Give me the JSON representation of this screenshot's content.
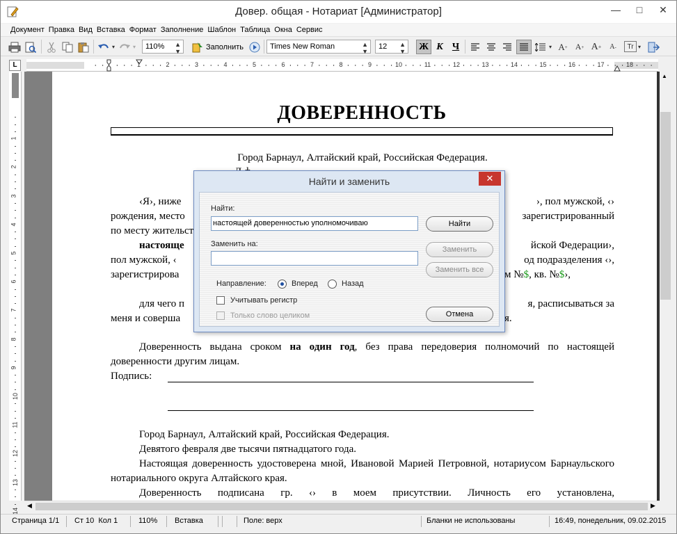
{
  "window": {
    "title": "Довер. общая - Нотариат [Администратор]"
  },
  "menu": [
    "Документ",
    "Правка",
    "Вид",
    "Вставка",
    "Формат",
    "Заполнение",
    "Шаблон",
    "Таблица",
    "Окна",
    "Сервис"
  ],
  "toolbar": {
    "zoom": "110%",
    "fill_label": "Заполнить",
    "font": "Times New Roman",
    "size": "12",
    "bold": "Ж",
    "italic": "К",
    "underline": "Ч"
  },
  "document": {
    "title": "ДОВЕРЕННОСТЬ",
    "city_line": "Город Барнаул, Алтайский край, Российская Федерация.",
    "date_line_fragment": "Д          ф",
    "p1_a": "‹Я›, ниже",
    "p1_b": "›, пол мужской, ‹›",
    "p1_c": "рождения, место",
    "p1_d": "зарегистрированный",
    "p1_e": "по месту жительства",
    "p2_a": "настояще",
    "p2_b": "йской Федерации›,",
    "p2_c": "пол мужской, ‹",
    "p2_d": "од подразделения ‹›,",
    "p2_e": "зарегистрирова",
    "p2_f": "м №",
    "p2_g": ", кв. №",
    "p2_h": "›,",
    "dollar": "$",
    "p3_a": "для чего п",
    "p3_b": "я, расписываться за",
    "p3_c": "меня и соверша",
    "p3_d": "я.",
    "p4_pre": "Доверенность выдана сроком ",
    "p4_bold": "на один год",
    "p4_post": ", без права передоверия полномочий по настоящей доверенности другим лицам.",
    "signature_label": "Подпись:",
    "cert_city": "Город Барнаул, Алтайский край, Российская Федерация.",
    "cert_date": "Девятого февраля две тысячи пятнадцатого года.",
    "cert_text": "Настоящая доверенность удостоверена мной, Ивановой Марией Петровной, нотариусом Барнаульского нотариального округа Алтайского края.",
    "cert_sign": "Доверенность подписана гр. ‹› в моем присутствии. Личность его установлена,"
  },
  "dialog": {
    "title": "Найти и заменить",
    "find_label": "Найти:",
    "find_value": "настоящей доверенностью уполномочиваю",
    "replace_label": "Заменить на:",
    "replace_value": "",
    "direction_label": "Направление:",
    "forward": "Вперед",
    "backward": "Назад",
    "match_case": "Учитывать регистр",
    "whole_word": "Только слово целиком",
    "btn_find": "Найти",
    "btn_replace": "Заменить",
    "btn_replace_all": "Заменить все",
    "btn_cancel": "Отмена"
  },
  "status": {
    "page": "Страница 1/1",
    "pos": "Ст 10  Кол 1",
    "zoom": "110%",
    "mode": "Вставка",
    "field": "Поле: верх",
    "forms": "Бланки не использованы",
    "datetime": "16:49, понедельник, 09.02.2015"
  },
  "ruler": {
    "h_labels": [
      "1",
      "2",
      "3",
      "4",
      "5",
      "6",
      "7",
      "8",
      "9",
      "10",
      "11",
      "12",
      "13",
      "14",
      "15",
      "16",
      "17",
      "18"
    ],
    "v_labels": [
      "1",
      "2",
      "3",
      "4",
      "5",
      "6",
      "7",
      "8",
      "9",
      "10",
      "11",
      "12",
      "13",
      "14"
    ]
  }
}
